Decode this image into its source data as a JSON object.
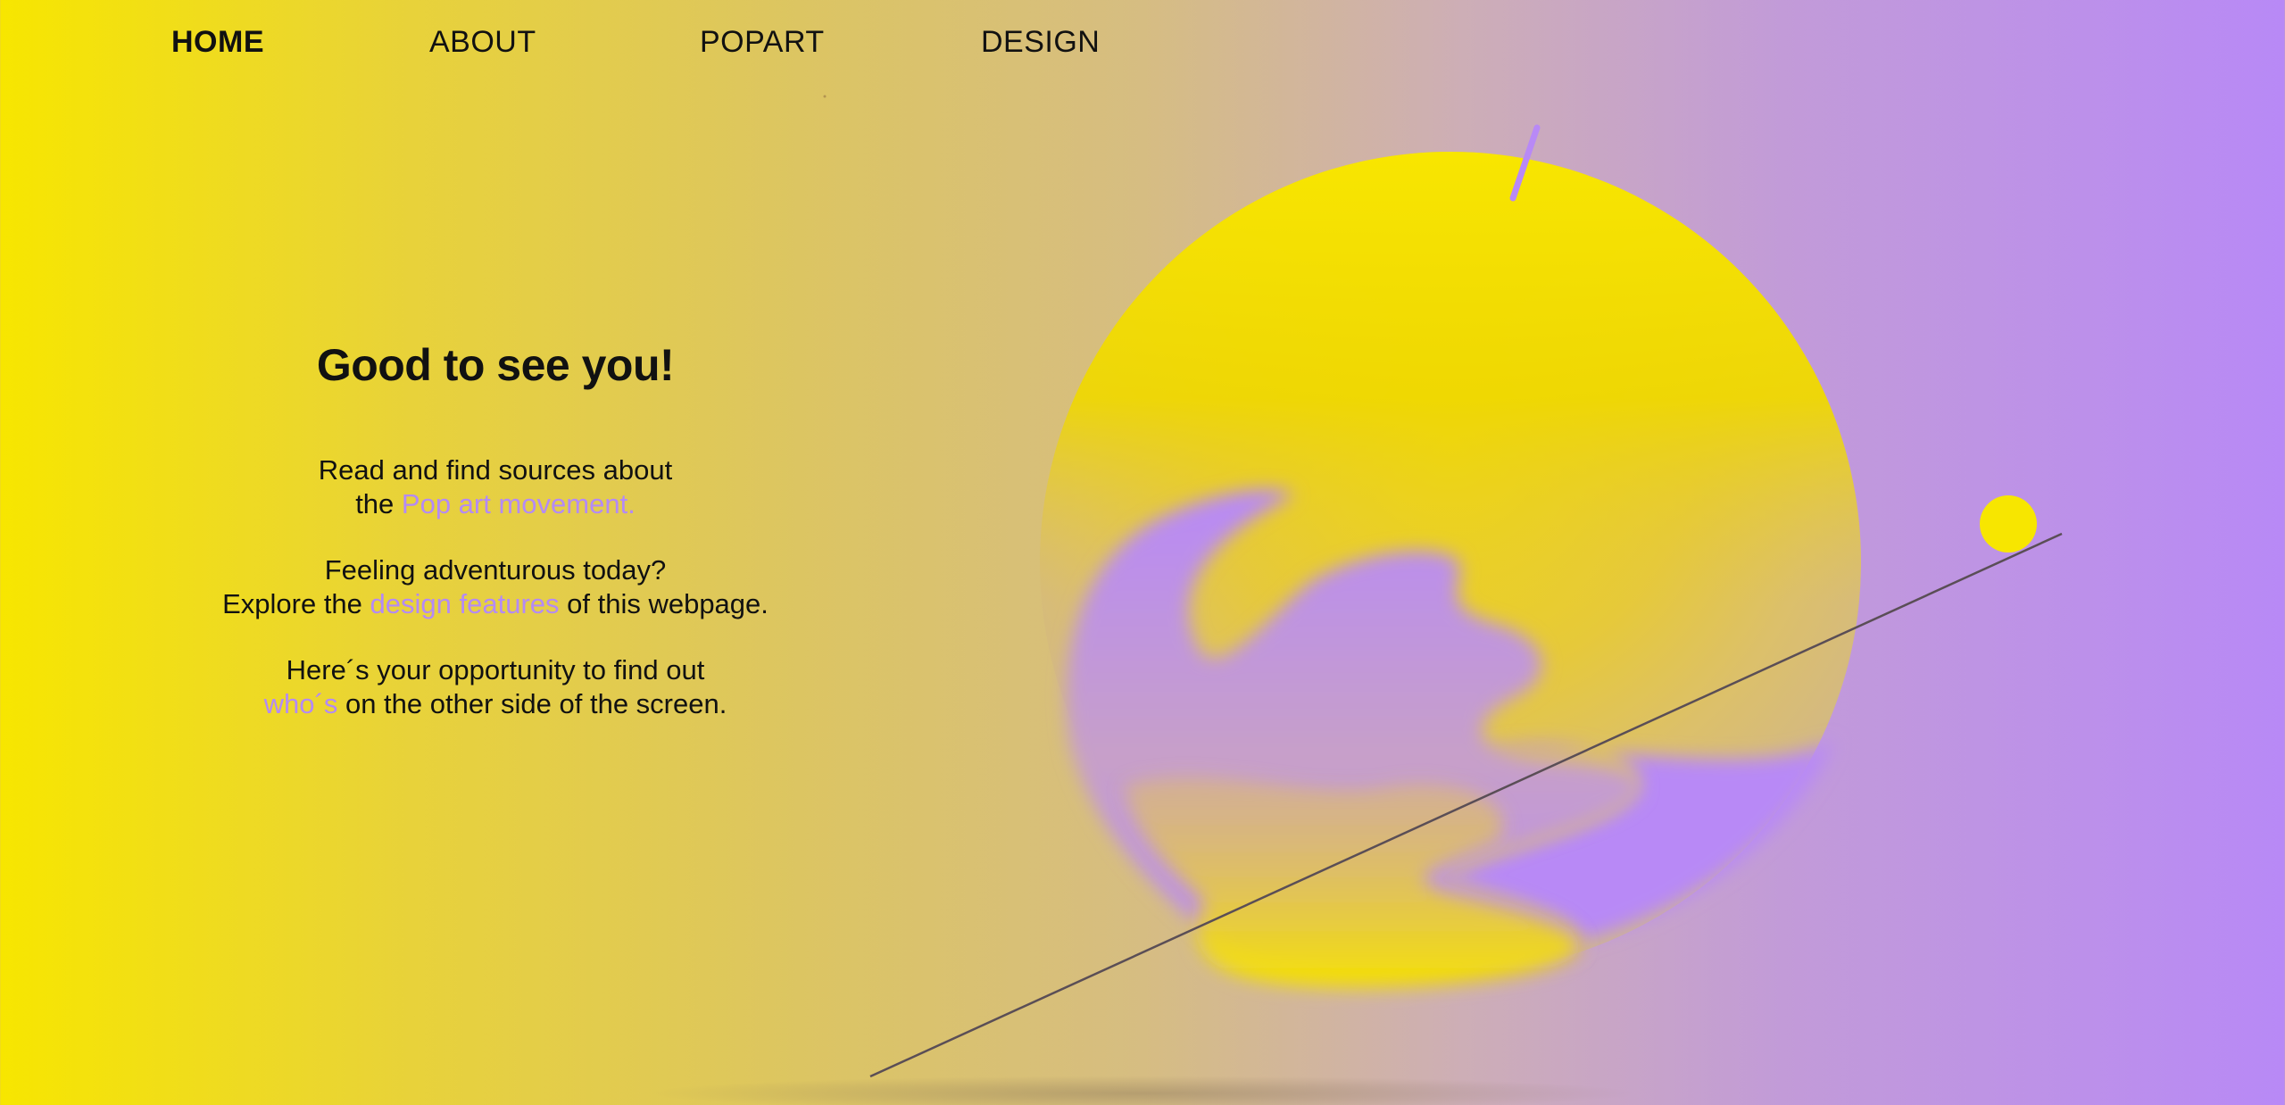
{
  "nav": {
    "items": [
      {
        "label": "HOME",
        "active": true
      },
      {
        "label": "ABOUT",
        "active": false
      },
      {
        "label": "POPART",
        "active": false
      },
      {
        "label": "DESIGN",
        "active": false
      }
    ]
  },
  "intro": {
    "title": "Good to see you!",
    "para1": {
      "line1": "Read and find sources about",
      "prefix": "the ",
      "link": "Pop art movement."
    },
    "para2": {
      "line1": "Feeling adventurous today?",
      "prefix": "Explore the ",
      "link": "design features",
      "suffix": " of this webpage."
    },
    "para3": {
      "line1": "Here´s your opportunity to find out",
      "link": "who´s",
      "suffix": " on the other side of the screen."
    }
  },
  "colors": {
    "yellow": "#f7e600",
    "purple": "#b889f6",
    "link": "#b48af6",
    "line": "#5a4e56"
  },
  "art": {
    "shapes": [
      "yellow-sphere",
      "purple-wave-blob",
      "small-yellow-dot",
      "diagonal-line",
      "purple-slash"
    ]
  }
}
